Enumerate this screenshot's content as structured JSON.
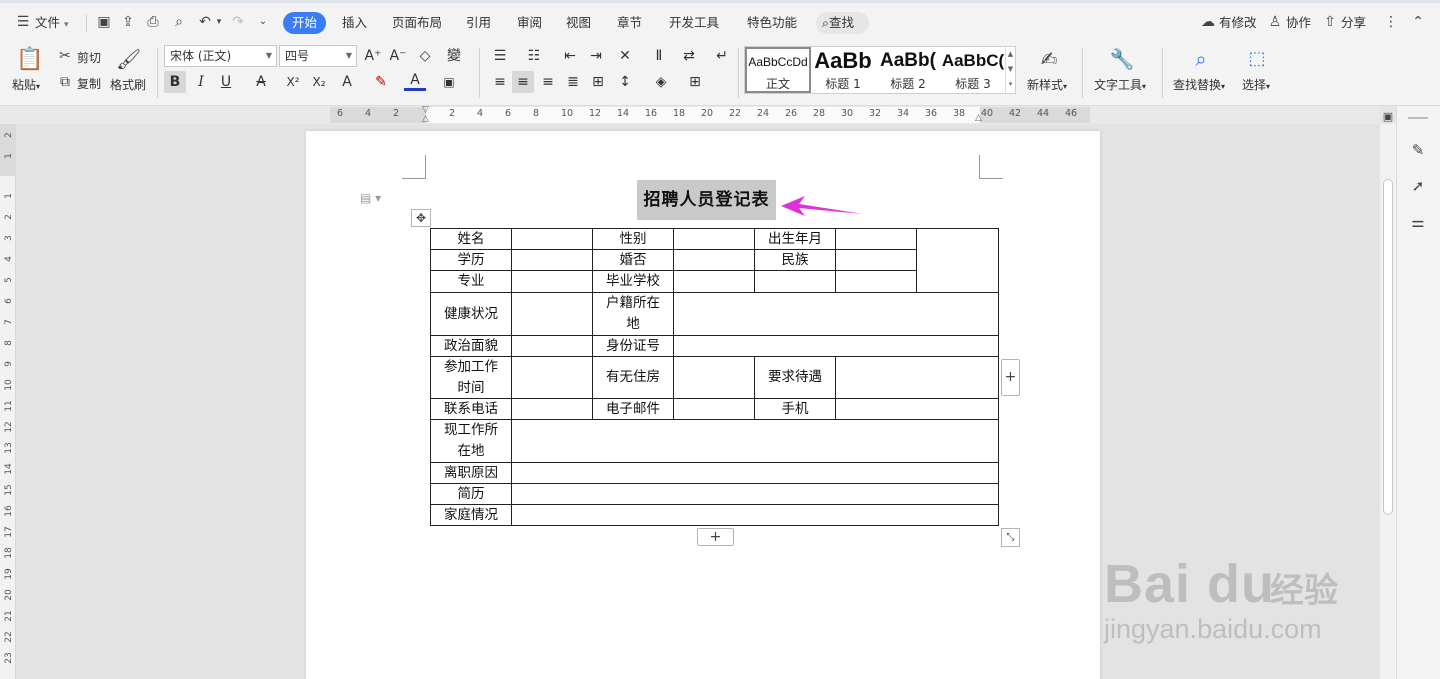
{
  "menubar": {
    "file": "文件",
    "tabs": [
      "开始",
      "插入",
      "页面布局",
      "引用",
      "审阅",
      "视图",
      "章节",
      "开发工具",
      "特色功能"
    ],
    "search": "查找",
    "right": {
      "modified": "有修改",
      "collab": "协作",
      "share": "分享"
    }
  },
  "ribbon": {
    "paste": "粘贴",
    "cut": "剪切",
    "copy": "复制",
    "format_painter": "格式刷",
    "font_name": "宋体 (正文)",
    "font_size": "四号",
    "bold": "B",
    "italic": "I",
    "underline": "U",
    "styles": [
      {
        "preview": "AaBbCcDd",
        "name": "正文"
      },
      {
        "preview": "AaBb",
        "name": "标题 1"
      },
      {
        "preview": "AaBb(",
        "name": "标题 2"
      },
      {
        "preview": "AaBbC(",
        "name": "标题 3"
      }
    ],
    "new_style": "新样式",
    "text_tools": "文字工具",
    "find_replace": "查找替换",
    "select": "选择"
  },
  "ruler": {
    "h_ticks": [
      "6",
      "4",
      "2",
      "2",
      "4",
      "6",
      "8",
      "10",
      "12",
      "14",
      "16",
      "18",
      "20",
      "22",
      "24",
      "26",
      "28",
      "30",
      "32",
      "34",
      "36",
      "38",
      "40",
      "42",
      "44",
      "46"
    ],
    "v_ticks": [
      "2",
      "1",
      "1",
      "2",
      "3",
      "4",
      "5",
      "6",
      "7",
      "8",
      "9",
      "10",
      "11",
      "12",
      "13",
      "14",
      "15",
      "16",
      "17",
      "18",
      "19",
      "20",
      "21",
      "22",
      "23"
    ]
  },
  "document": {
    "title": "招聘人员登记表",
    "table": {
      "name": "姓名",
      "gender": "性别",
      "birth": "出生年月",
      "education": "学历",
      "marital": "婚否",
      "ethnicity": "民族",
      "major": "专业",
      "school": "毕业学校",
      "health": "健康状况",
      "hukou": "户籍所在地",
      "politics": "政治面貌",
      "id_number": "身份证号",
      "work_time": "参加工作时间",
      "housing": "有无住房",
      "salary": "要求待遇",
      "phone": "联系电话",
      "email": "电子邮件",
      "mobile": "手机",
      "current_work": "现工作所在地",
      "leave_reason": "离职原因",
      "resume": "简历",
      "family": "家庭情况"
    }
  },
  "watermark": {
    "logo": "Bai du",
    "cn": "经验",
    "url": "jingyan.baidu.com"
  },
  "colors": {
    "accent": "#3a7cf5",
    "arrow": "#e030d8"
  }
}
